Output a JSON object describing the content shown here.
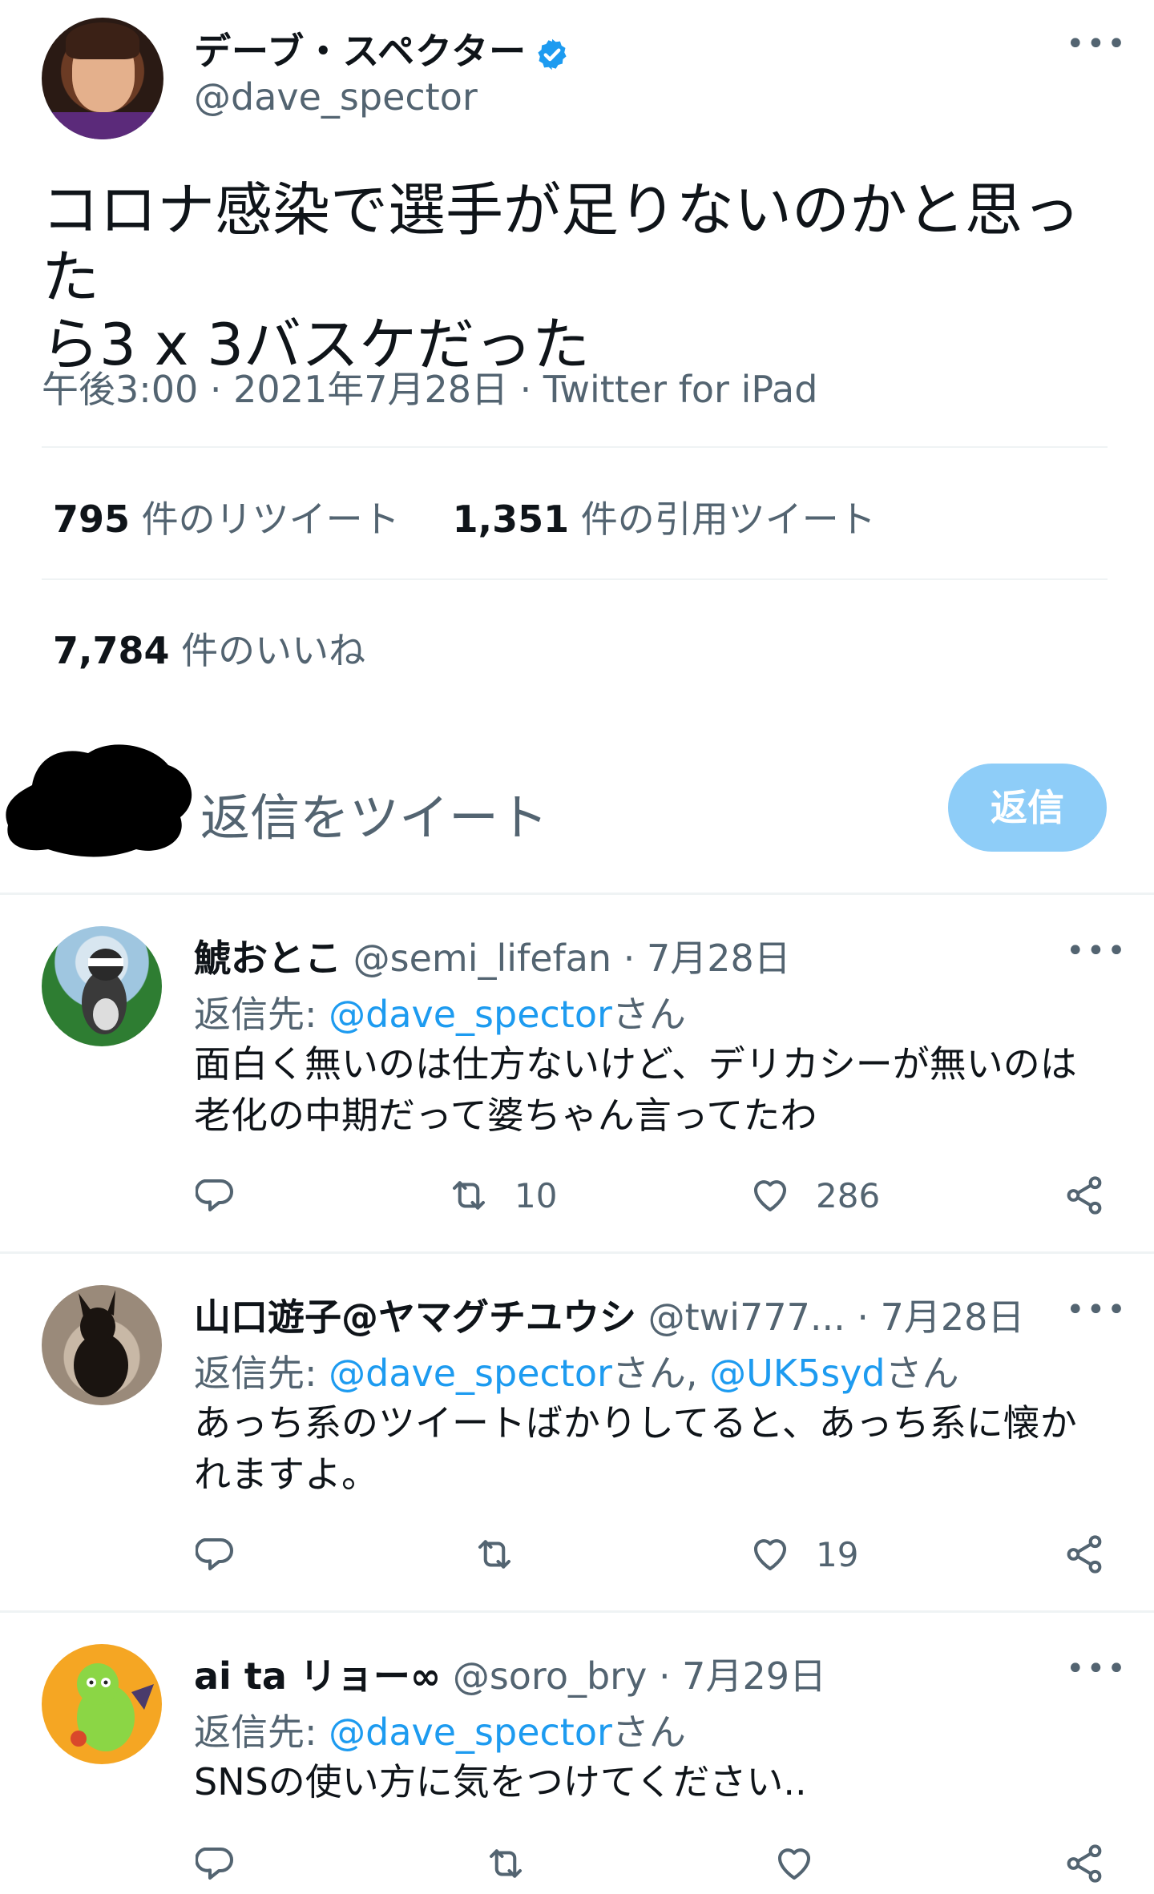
{
  "main_tweet": {
    "author": {
      "name": "デーブ・スペクター",
      "handle": "@dave_spector",
      "verified": true
    },
    "text": "コロナ感染で選手が足りないのかと思った\nら3 x 3バスケだった",
    "meta": "午後3:00 · 2021年7月28日 · Twitter for iPad",
    "stats": {
      "retweets_count": "795",
      "retweets_label": "件のリツイート",
      "quotes_count": "1,351",
      "quotes_label": "件の引用ツイート",
      "likes_count": "7,784",
      "likes_label": "件のいいね"
    }
  },
  "composer": {
    "placeholder": "返信をツイート",
    "button_label": "返信"
  },
  "replies": [
    {
      "name": "鯱おとこ",
      "handle": "@semi_lifefan",
      "date": "· 7月28日",
      "reply_to_prefix": "返信先: ",
      "mentions": [
        {
          "handle": "@dave_spector",
          "suffix": "さん"
        }
      ],
      "text": "面白く無いのは仕方ないけど、デリカシーが無いのは\n老化の中期だって婆ちゃん言ってたわ",
      "retweets": "10",
      "likes": "286"
    },
    {
      "name": "山口遊子@ヤマグチユウシ",
      "handle": "@twi777...",
      "date": "· 7月28日",
      "reply_to_prefix": "返信先: ",
      "mentions": [
        {
          "handle": "@dave_spector",
          "suffix": "さん, "
        },
        {
          "handle": "@UK5syd",
          "suffix": "さん"
        }
      ],
      "text": "あっち系のツイートばかりしてると、あっち系に懐か\nれますよ。",
      "retweets": "",
      "likes": "19"
    },
    {
      "name": "ai ta リョー∞",
      "handle": "@soro_bry",
      "date": "· 7月29日",
      "reply_to_prefix": "返信先: ",
      "mentions": [
        {
          "handle": "@dave_spector",
          "suffix": "さん"
        }
      ],
      "text": "SNSの使い方に気をつけてください..",
      "retweets": "",
      "likes": ""
    }
  ],
  "icons": {
    "more": "more-horizontal-icon",
    "verified": "verified-badge-icon",
    "reply": "reply-bubble-icon",
    "retweet": "retweet-icon",
    "like": "heart-icon",
    "share": "share-icon"
  },
  "colors": {
    "accent": "#1d9bf0",
    "button_disabled": "#8ecdf8",
    "secondary_text": "#536471",
    "primary_text": "#0f1419"
  }
}
